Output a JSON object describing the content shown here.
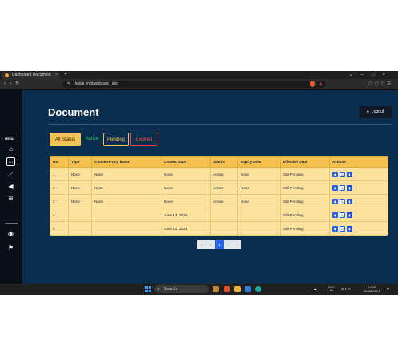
{
  "browser": {
    "tab_title": "Dashboard Document",
    "url": "lexlai.vn/dashboard_doc"
  },
  "sidebar": {
    "menu_label": "MENU",
    "icons": [
      "home-icon",
      "document-icon",
      "chart-icon",
      "megaphone-icon",
      "layers-icon",
      "globe-icon",
      "flag-icon"
    ]
  },
  "page": {
    "title": "Document",
    "logout_label": "Logout"
  },
  "filters": {
    "all": "All Status",
    "active": "Active",
    "pending": "Pending",
    "expired": "Expired"
  },
  "table": {
    "headers": [
      "No.",
      "Type",
      "Counter Party Name",
      "Created Date",
      "Status",
      "Expiry Date",
      "Effective Date",
      "Actions"
    ],
    "rows": [
      [
        "1",
        "None",
        "None",
        "None",
        "Active",
        "None",
        "Still Pending"
      ],
      [
        "2",
        "None",
        "None",
        "None",
        "Active",
        "None",
        "Still Pending"
      ],
      [
        "3",
        "None",
        "None",
        "None",
        "Active",
        "None",
        "Still Pending"
      ],
      [
        "4",
        "",
        "",
        "June 13, 2024",
        "",
        "",
        "Still Pending"
      ],
      [
        "5",
        "",
        "",
        "June 13, 2024",
        "",
        "",
        "Still Pending"
      ]
    ]
  },
  "pagination": {
    "first": "«",
    "prev": "‹",
    "current": "1",
    "next": "›",
    "last": "»"
  },
  "taskbar": {
    "search_placeholder": "Search",
    "lang_top": "ENG",
    "lang_bottom": "IN",
    "time": "14:05",
    "date": "18-06-2024"
  },
  "colors": {
    "page_bg": "#0b2e4f",
    "accent_yellow": "#f2c256",
    "active_green": "#22c55e",
    "expired_red": "#ef4444",
    "primary_blue": "#2563eb"
  }
}
